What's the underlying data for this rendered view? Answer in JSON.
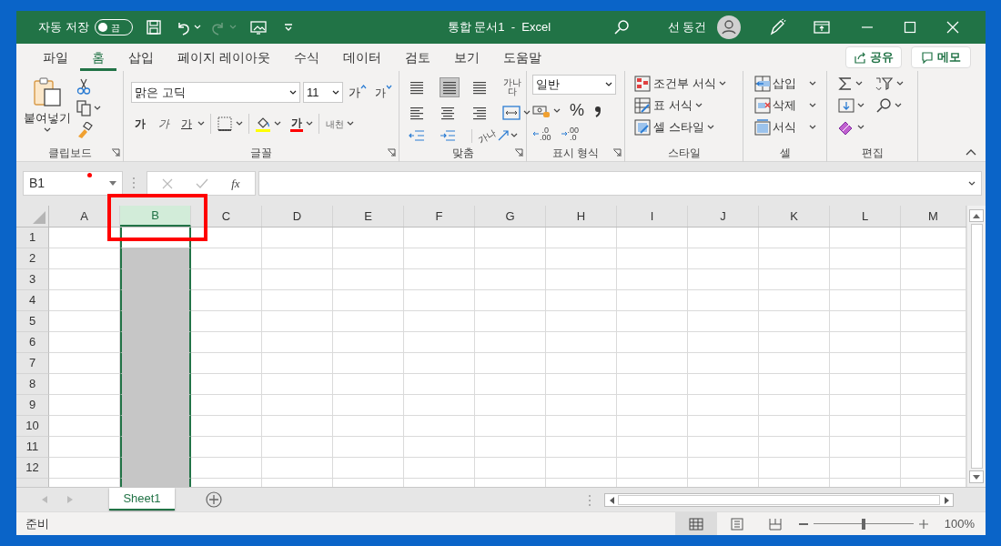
{
  "title_bar": {
    "autosave_label": "자동 저장",
    "autosave": {
      "label": "끔",
      "on": false
    },
    "title": "통합 문서1  -  Excel",
    "user": "선 동건"
  },
  "tabs": [
    {
      "label": "파일",
      "selected": false
    },
    {
      "label": "홈",
      "selected": true
    },
    {
      "label": "삽입",
      "selected": false
    },
    {
      "label": "페이지 레이아웃",
      "selected": false
    },
    {
      "label": "수식",
      "selected": false
    },
    {
      "label": "데이터",
      "selected": false
    },
    {
      "label": "검토",
      "selected": false
    },
    {
      "label": "보기",
      "selected": false
    },
    {
      "label": "도움말",
      "selected": false
    }
  ],
  "share_button": "공유",
  "comments_button": "메모",
  "ribbon": {
    "clipboard": {
      "group_label": "클립보드",
      "paste": "붙여넣기"
    },
    "font": {
      "group_label": "글꼴",
      "font_name": "맑은 고딕",
      "font_size": "11",
      "grow": "가",
      "shrink": "가",
      "bold": "가",
      "italic": "가",
      "underline": "가",
      "font_color": "가",
      "phonetic": "내천"
    },
    "alignment": {
      "group_label": "맞춤",
      "wrap_text": "가나다",
      "orientation": "가나"
    },
    "number": {
      "group_label": "표시 형식",
      "format": "일반",
      "percent": "%",
      "increase_decimal": [
        ".0",
        ".00"
      ],
      "decrease_decimal": [
        ".00",
        ".0"
      ]
    },
    "styles": {
      "group_label": "스타일",
      "items": [
        "조건부 서식",
        "표 서식",
        "셀 스타일"
      ]
    },
    "cells": {
      "group_label": "셀",
      "items": [
        "삽입",
        "삭제",
        "서식"
      ]
    },
    "editing": {
      "group_label": "편집"
    }
  },
  "formula_bar": {
    "name_box": "B1",
    "function_label": "fx"
  },
  "sheet": {
    "columns": [
      {
        "label": "A",
        "selected": false
      },
      {
        "label": "B",
        "selected": true
      },
      {
        "label": "C",
        "selected": false
      },
      {
        "label": "D",
        "selected": false
      },
      {
        "label": "E",
        "selected": false
      },
      {
        "label": "F",
        "selected": false
      },
      {
        "label": "G",
        "selected": false
      },
      {
        "label": "H",
        "selected": false
      },
      {
        "label": "I",
        "selected": false
      },
      {
        "label": "J",
        "selected": false
      },
      {
        "label": "K",
        "selected": false
      },
      {
        "label": "L",
        "selected": false
      },
      {
        "label": "M",
        "selected": false
      }
    ],
    "rows": [
      "1",
      "2",
      "3",
      "4",
      "5",
      "6",
      "7",
      "8",
      "9",
      "10",
      "11",
      "12"
    ]
  },
  "sheet_tabs": [
    {
      "label": "Sheet1",
      "selected": true
    }
  ],
  "status_bar": {
    "status": "준비",
    "zoom": "100%",
    "zoom_slider": {
      "level": 0.5
    }
  },
  "annotations": [
    {
      "kind": "rectangle"
    },
    {
      "kind": "dot"
    }
  ]
}
